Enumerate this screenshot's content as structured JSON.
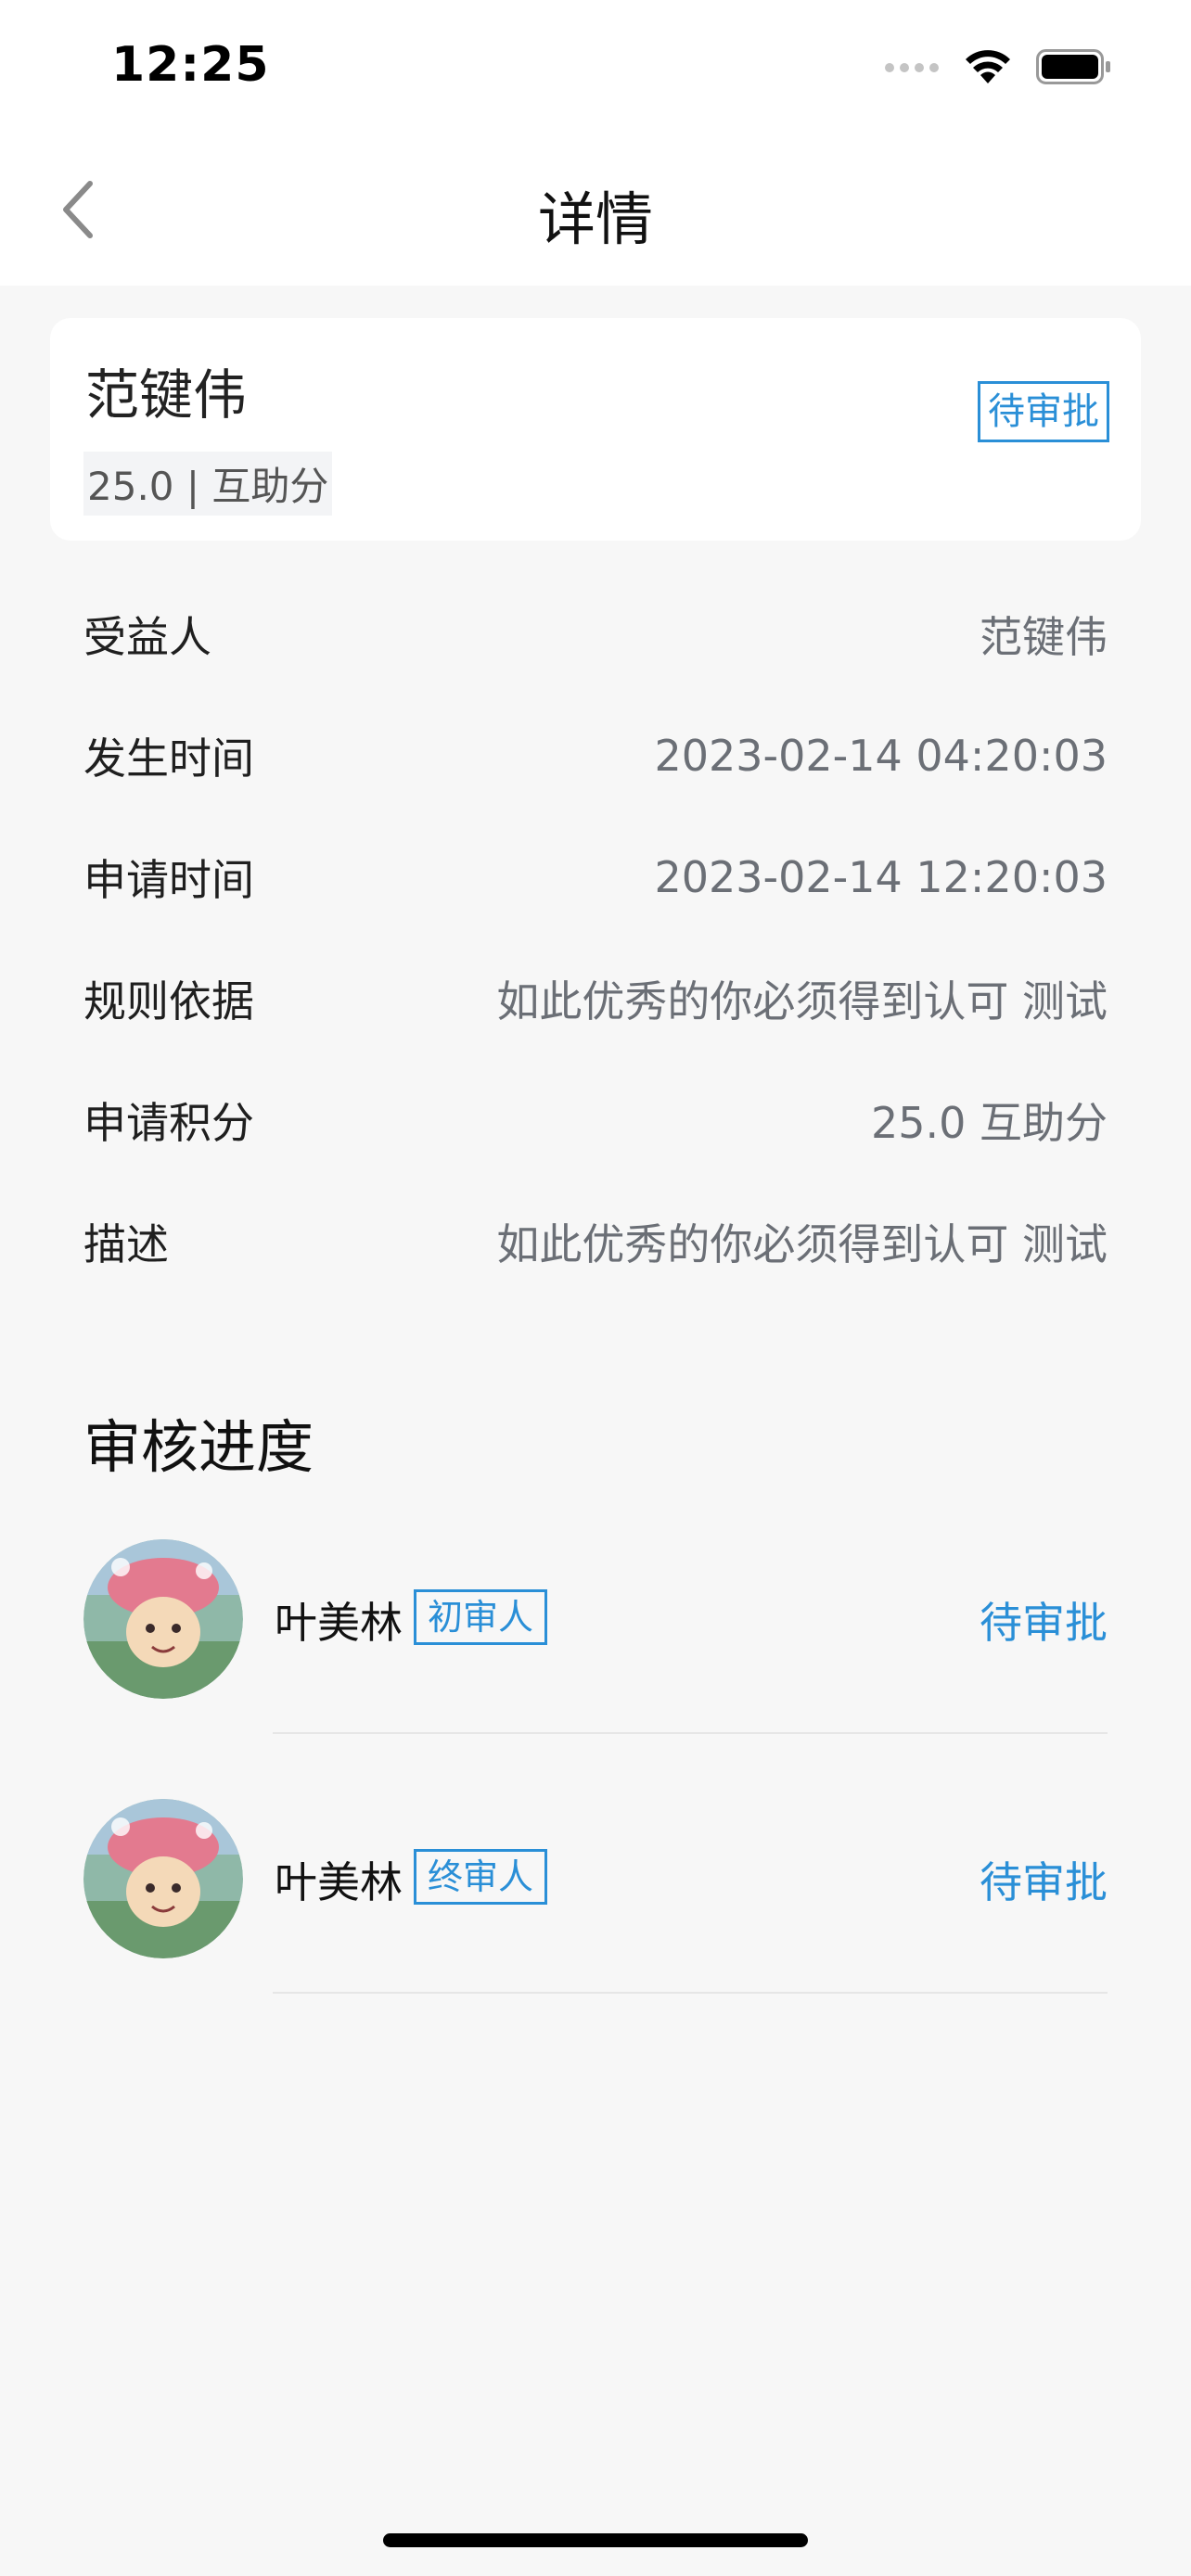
{
  "status_bar": {
    "time": "12:25",
    "icons": [
      "signal-icon",
      "wifi-icon",
      "battery-icon"
    ]
  },
  "nav": {
    "title": "详情",
    "back_icon": "chevron-left-icon"
  },
  "summary": {
    "name": "范键伟",
    "subtitle": "25.0 | 互助分",
    "status": "待审批"
  },
  "details": [
    {
      "label": "受益人",
      "value": "范键伟"
    },
    {
      "label": "发生时间",
      "value": "2023-02-14 04:20:03"
    },
    {
      "label": "申请时间",
      "value": "2023-02-14 12:20:03"
    },
    {
      "label": "规则依据",
      "value": "如此优秀的你必须得到认可  测试"
    },
    {
      "label": "申请积分",
      "value": "25.0 互助分"
    },
    {
      "label": "描述",
      "value": "如此优秀的你必须得到认可  测试"
    }
  ],
  "progress": {
    "title": "审核进度",
    "approvers": [
      {
        "name": "叶美林",
        "role": "初审人",
        "status": "待审批"
      },
      {
        "name": "叶美林",
        "role": "终审人",
        "status": "待审批"
      }
    ]
  },
  "colors": {
    "accent": "#2a8fd7",
    "background": "#f7f7f7",
    "card": "#ffffff",
    "value_text": "#6b6f76"
  }
}
